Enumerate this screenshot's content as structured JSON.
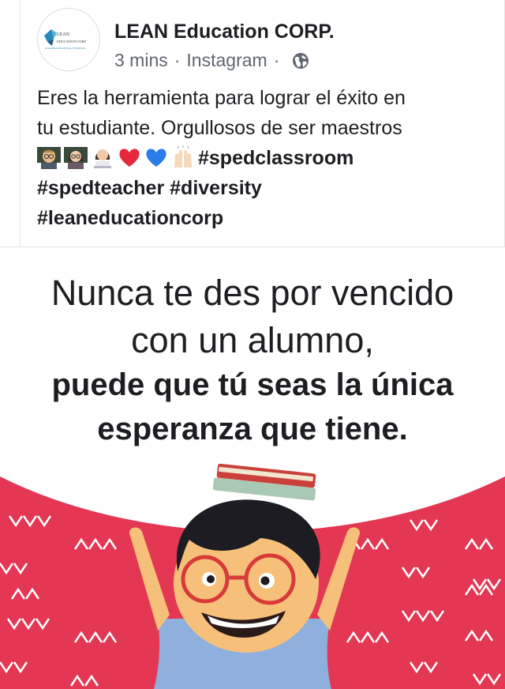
{
  "post": {
    "author": "LEAN Education CORP.",
    "time": "3 mins",
    "source": "Instagram",
    "separator": "·",
    "privacy_icon": "globe-icon",
    "avatar_text": {
      "line1": "LEAN",
      "line2": "EDUCATION CORP",
      "line3": "ACCESSIBLE EDUCATIONAL SYSTEMS INC"
    },
    "text_line1": "Eres la herramienta para lograr el éxito en",
    "text_line2": "tu estudiante. Orgullosos de ser maestros",
    "emojis": [
      "teacher-icon",
      "woman-teacher-icon",
      "woman-technologist-icon",
      "red-heart-icon",
      "blue-heart-icon",
      "raising-hands-icon"
    ],
    "hashtag_1": "#spedclassroom",
    "hashtag_2": "#spedteacher",
    "hashtag_3": "#diversity",
    "hashtag_4": "#leaneducationcorp"
  },
  "image": {
    "quote_line1": "Nunca te des por vencido",
    "quote_line2": "con un alumno,",
    "quote_line3": "puede que tú seas la única",
    "quote_line4": "esperanza que tiene.",
    "colors": {
      "background": "#ffffff",
      "red": "#e33754",
      "skin": "#f7c07a",
      "hair": "#1c1c22",
      "shirt": "#8fb0dd",
      "glasses": "#d83a3a",
      "book_red": "#c9413a",
      "book_green": "#a9c9b5"
    }
  }
}
